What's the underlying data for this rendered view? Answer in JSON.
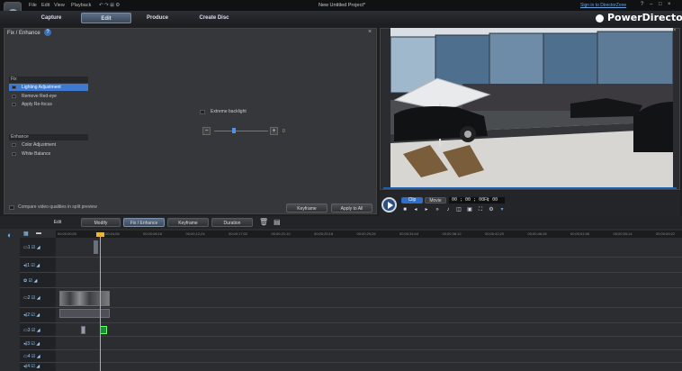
{
  "app": {
    "menu": [
      "File",
      "Edit",
      "View",
      "Playback"
    ],
    "project_title": "New Untitled Project*",
    "sign_in": "Sign in to DirectorZone",
    "brand": "PowerDirector",
    "window_buttons": [
      "?",
      "–",
      "□",
      "×"
    ]
  },
  "modes": [
    "Capture",
    "Edit",
    "Produce",
    "Create Disc"
  ],
  "fix_panel": {
    "title": "Fix / Enhance",
    "fix_group": "Fix",
    "fix_items": [
      "Lighting Adjustment",
      "Remove Red-eye",
      "Apply Re-focus"
    ],
    "enhance_group": "Enhance",
    "enhance_items": [
      "Color Adjustment",
      "White Balance"
    ],
    "extreme_backlight": "Extreme backlight",
    "slider_value": "0",
    "compare_label": "Compare video qualities in split preview",
    "keyframe_btn": "Keyframe",
    "apply_all_btn": "Apply to All"
  },
  "player": {
    "clip_label": "Clip",
    "movie_label": "Movie",
    "timecode": "00 ; 00 ; 00 ; 00",
    "zoom": "Fit"
  },
  "edit_toolbar": [
    "Edit",
    "Modify",
    "Fix / Enhance",
    "Keyframe",
    "Duration"
  ],
  "ruler_ticks": [
    "00;00;00;00",
    "00;00;04;08",
    "00;00;08;16",
    "00;00;12;24",
    "00;00;17;02",
    "00;00;21;10",
    "00;00;25;18",
    "00;00;29;26",
    "00;00;34;04",
    "00;00;38;12",
    "00;00;42;20",
    "00;00;46;28",
    "00;00;51;06",
    "00;00;55;14",
    "00;00;59;22"
  ],
  "track_labels": [
    "1",
    "1",
    "",
    "2",
    "2",
    "3",
    "3",
    "4",
    "4"
  ],
  "colors": {
    "accent": "#3f7ad0",
    "playhead": "#3fe0d0",
    "brand_bg": "#101113"
  }
}
